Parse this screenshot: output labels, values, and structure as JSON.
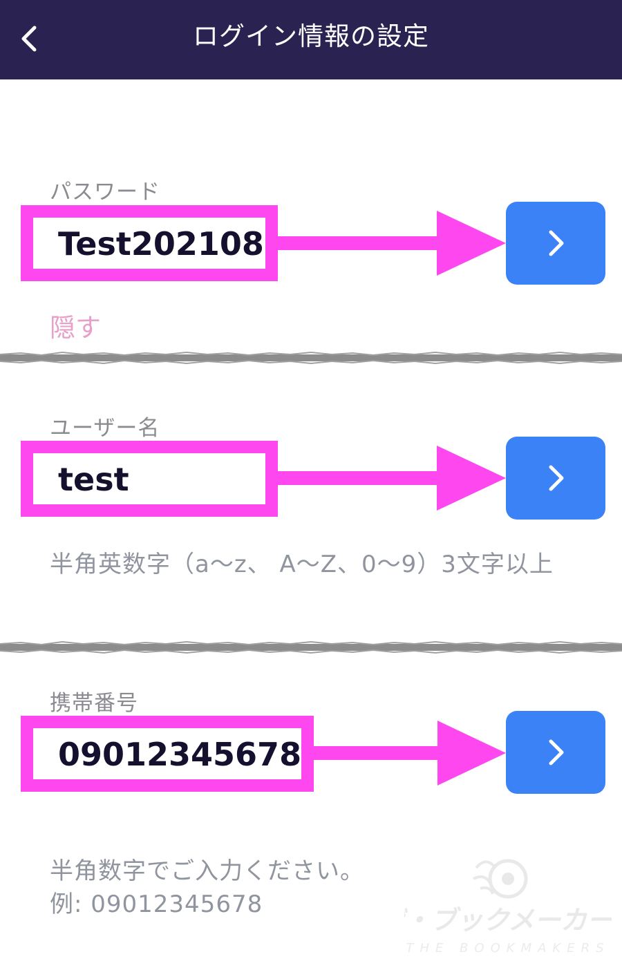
{
  "header": {
    "title": "ログイン情報の設定",
    "back_icon": "chevron-left-icon"
  },
  "colors": {
    "header_bg": "#2a2250",
    "highlight": "#ff47f0",
    "button": "#3b82f6",
    "hide_link": "#e7a0c9",
    "hint_text": "#8f949e"
  },
  "password": {
    "label": "パスワード",
    "value": "Test202108",
    "hide_label": "隠す"
  },
  "username": {
    "label": "ユーザー名",
    "value": "test",
    "hint": "半角英数字（a〜z、 A〜Z、0〜9）3文字以上"
  },
  "phone": {
    "label": "携帯番号",
    "value": "09012345678",
    "hint_line1": "半角数字でご入力ください。",
    "hint_line2": "例: 09012345678"
  },
  "watermark": {
    "text_jp": "ザ・ブックメーカーズ",
    "text_en": "THE BOOKMAKERS"
  }
}
